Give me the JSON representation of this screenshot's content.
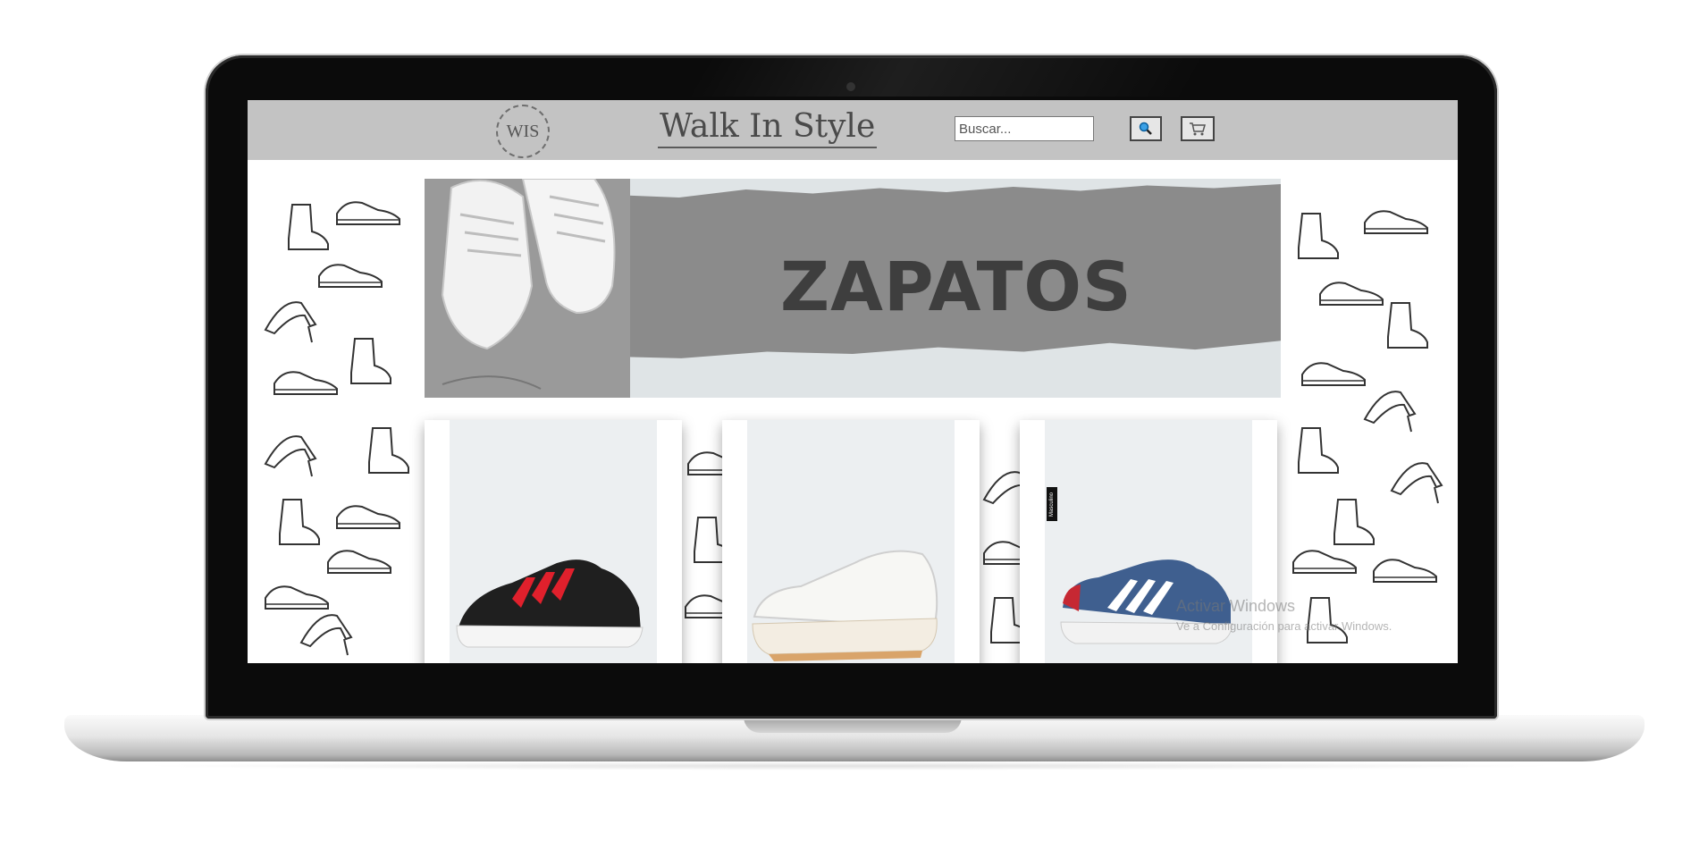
{
  "header": {
    "logo_text": "WIS",
    "site_title": "Walk In Style",
    "search_placeholder": "Buscar...",
    "search_icon": "search-icon",
    "cart_icon": "cart-icon"
  },
  "banner": {
    "title": "ZAPATOS"
  },
  "products": [
    {
      "description": "black sneaker with red stripes",
      "tag": ""
    },
    {
      "description": "white platform sneaker",
      "tag": ""
    },
    {
      "description": "blue sneaker with white stripes",
      "tag": "Masculino"
    }
  ],
  "watermark": {
    "line1": "Activar Windows",
    "line2": "Ve a Configuración para activar Windows."
  },
  "colors": {
    "header_bg": "#c3c3c3",
    "banner_band": "#8b8b8b",
    "banner_text": "#3e3e3e",
    "card_bg": "#eceff1"
  }
}
